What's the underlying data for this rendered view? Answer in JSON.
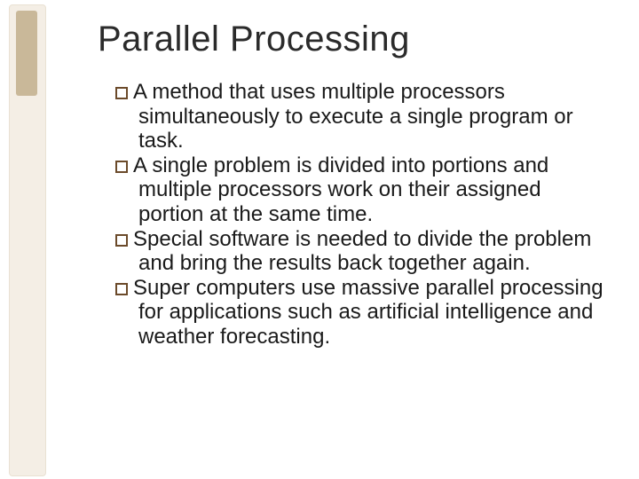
{
  "title": "Parallel Processing",
  "bullets": [
    "A method that uses multiple processors simultaneously to execute a single program or task.",
    "A single problem is divided into portions and multiple processors work on their assigned portion at the same time.",
    "Special software is needed to divide the problem and bring the results back together again.",
    "Super computers use massive parallel processing for applications such as artificial intelligence and weather forecasting."
  ]
}
